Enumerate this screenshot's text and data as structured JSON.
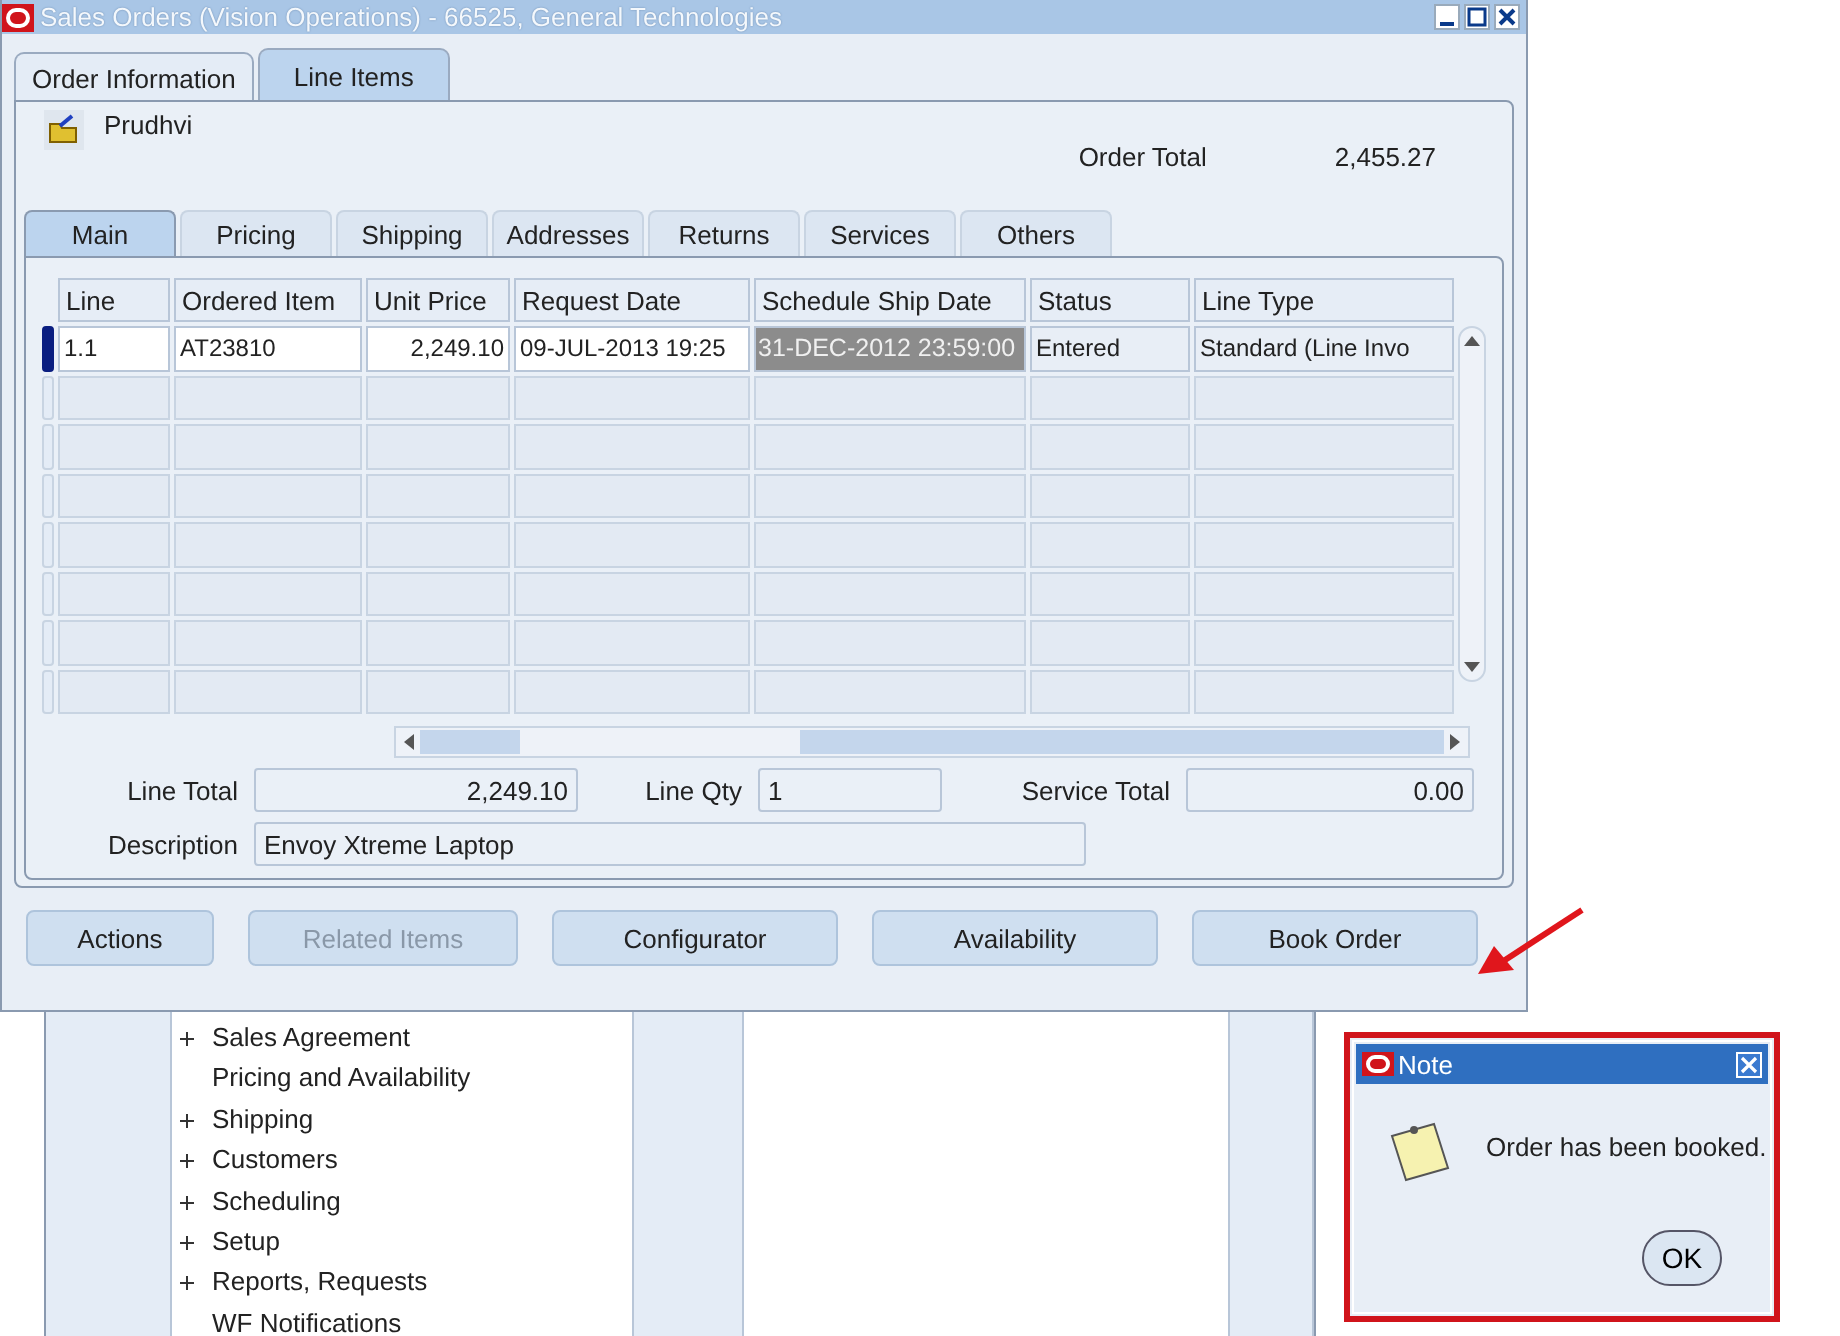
{
  "window": {
    "title": "Sales Orders (Vision Operations) - 66525, General Technologies"
  },
  "tabs": [
    {
      "label": "Order Information",
      "selected": false
    },
    {
      "label": "Line Items",
      "selected": true
    }
  ],
  "customer": "Prudhvi",
  "order_total": {
    "label": "Order Total",
    "value": "2,455.27"
  },
  "sub_tabs": [
    {
      "label": "Main",
      "selected": true
    },
    {
      "label": "Pricing",
      "selected": false
    },
    {
      "label": "Shipping",
      "selected": false
    },
    {
      "label": "Addresses",
      "selected": false
    },
    {
      "label": "Returns",
      "selected": false
    },
    {
      "label": "Services",
      "selected": false
    },
    {
      "label": "Others",
      "selected": false
    }
  ],
  "table": {
    "columns": [
      "Line",
      "Ordered Item",
      "Unit Price",
      "Request Date",
      "Schedule Ship Date",
      "Status",
      "Line Type"
    ],
    "rows": [
      {
        "selected": true,
        "cells": [
          {
            "text": "1.1",
            "highlighted": false
          },
          {
            "text": "AT23810",
            "highlighted": false
          },
          {
            "text": "2,249.10",
            "highlighted": false
          },
          {
            "text": "09-JUL-2013 19:25",
            "highlighted": false
          },
          {
            "text": "31-DEC-2012 23:59:00",
            "highlighted": true
          },
          {
            "text": "Entered",
            "highlighted": false
          },
          {
            "text": "Standard (Line Invo",
            "highlighted": false
          }
        ]
      },
      {
        "selected": false
      },
      {
        "selected": false
      },
      {
        "selected": false
      },
      {
        "selected": false
      },
      {
        "selected": false
      },
      {
        "selected": false
      },
      {
        "selected": false
      }
    ]
  },
  "fields": {
    "line_total": {
      "label": "Line Total",
      "value": "2,249.10"
    },
    "line_qty": {
      "label": "Line Qty",
      "value": "1"
    },
    "service_total": {
      "label": "Service Total",
      "value": "0.00"
    },
    "description": {
      "label": "Description",
      "value": "Envoy Xtreme Laptop"
    }
  },
  "buttons": [
    {
      "label": "Actions",
      "disabled": false
    },
    {
      "label": "Related Items",
      "disabled": true
    },
    {
      "label": "Configurator",
      "disabled": false
    },
    {
      "label": "Availability",
      "disabled": false
    },
    {
      "label": "Book Order",
      "disabled": false
    }
  ],
  "navigator": {
    "items": [
      {
        "label": "Sales Agreement",
        "expandable": true
      },
      {
        "label": "Pricing and Availability",
        "expandable": false
      },
      {
        "label": "Shipping",
        "expandable": true
      },
      {
        "label": "Customers",
        "expandable": true
      },
      {
        "label": "Scheduling",
        "expandable": true
      },
      {
        "label": "Setup",
        "expandable": true
      },
      {
        "label": "Reports, Requests",
        "expandable": true
      },
      {
        "label": "WF Notifications",
        "expandable": false
      }
    ]
  },
  "note_dialog": {
    "title": "Note",
    "message": "Order has been booked.",
    "button": "OK"
  }
}
